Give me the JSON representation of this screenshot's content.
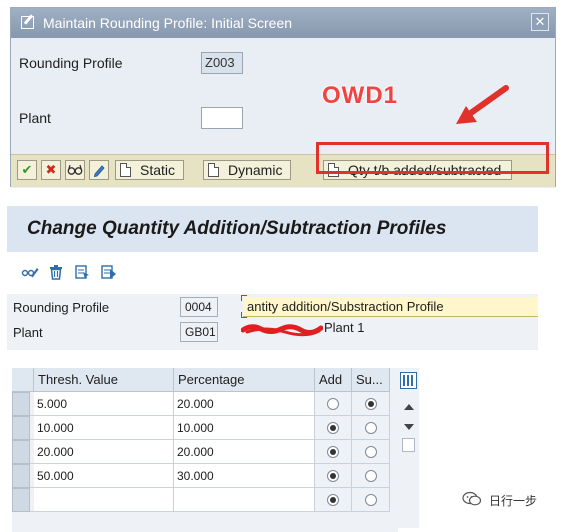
{
  "dialog": {
    "title": "Maintain Rounding Profile: Initial Screen",
    "close_glyph": "✕",
    "rounding_profile_label": "Rounding Profile",
    "rounding_profile_value": "Z003",
    "plant_label": "Plant",
    "plant_value": "",
    "buttons": {
      "execute_icon": "checkmark-icon",
      "cancel_icon": "cancel-icon",
      "glasses_icon": "display-icon",
      "pencil_icon": "change-icon",
      "static_label": "Static",
      "dynamic_label": "Dynamic",
      "qty_label": "Qty t/b added/subtracted"
    }
  },
  "annotation": {
    "text": "OWD1",
    "color": "#e0312a"
  },
  "screen": {
    "title": "Change Quantity Addition/Subtraction Profiles",
    "toolbar_icons": [
      "display-change-icon",
      "delete-icon",
      "select-all-icon",
      "deselect-all-icon"
    ],
    "rounding_profile_label": "Rounding Profile",
    "rounding_profile_value": "0004",
    "description": "antity addition/Substraction Profile",
    "plant_label": "Plant",
    "plant_value": "GB01",
    "plant_name": "Plant 1"
  },
  "table": {
    "headers": {
      "thresh": "Thresh. Value",
      "percentage": "Percentage",
      "add": "Add",
      "sub": "Su..."
    },
    "rows": [
      {
        "thresh": "5.000",
        "percentage": "20.000",
        "add": false,
        "sub": true
      },
      {
        "thresh": "10.000",
        "percentage": "10.000",
        "add": true,
        "sub": false
      },
      {
        "thresh": "20.000",
        "percentage": "20.000",
        "add": true,
        "sub": false
      },
      {
        "thresh": "50.000",
        "percentage": "30.000",
        "add": true,
        "sub": false
      },
      {
        "thresh": "",
        "percentage": "",
        "add": true,
        "sub": false
      }
    ]
  },
  "watermark": {
    "text": "日行一步"
  },
  "colors": {
    "title_bar": "#8fa1b7",
    "button_bar": "#e6e2c4",
    "screen_title_bg": "#dbe5f1",
    "highlight": "#e0312a"
  }
}
